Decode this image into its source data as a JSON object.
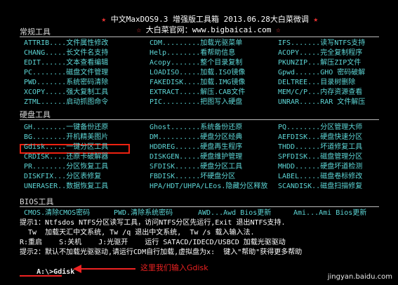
{
  "header": {
    "title_line": "中文MaxDOS9.3 增强版工具箱 2013.06.28大白菜微调",
    "site_line": "大白菜官网：www.bigbaicai.com"
  },
  "sections": {
    "common": "常规工具",
    "disk": "硬盘工具",
    "bios": "BIOS工具"
  },
  "common_rows": [
    [
      "ATTRIB....文件属性修改",
      "CDM.........加载光驱菜单",
      "IFS.......读写NTFS支持"
    ],
    [
      "CHANG.....长文件名支持",
      "Help........看帮助信息",
      "ACOPY.....完全复制程序"
    ],
    [
      "EDIT......文本查看编辑",
      "Acopy.......整个目录复制",
      "PKUNZIP...解压ZIP文件"
    ],
    [
      "PC........磁盘文件管理",
      "LOADISO.....加载.ISO镜像",
      "Gpwd......GHO 密码破解"
    ],
    [
      "PWD.......系统密码清除",
      "FAKEDISK....加载.IMG镜像",
      "DELTREE...目录树删除"
    ],
    [
      "XCOPY.....强大复制工具",
      "EXTRACT.....解压.CAB文件",
      "MEM/C/P...内存资源查看"
    ],
    [
      "ZTML......启动抓图命令",
      "PIC.........把图写入硬盘",
      "UNRAR.....RAR 文件解压"
    ]
  ],
  "disk_rows": [
    [
      "GH........一键备份还原",
      "Ghost.......系统备份还原",
      "PQ........分区管理大师"
    ],
    [
      "BG........开机精美图片",
      "DM..........硬盘分区经典",
      "AEFDISK...硬盘快速分区"
    ],
    [
      "Gdisk.....一键分区工具",
      "HDDREG......硬盘再生程序",
      "THDD......坏道修复工具"
    ],
    [
      "CRDISK....还原卡破解器",
      "DISKGEN.....硬盘维护管理",
      "SPFDISK...磁盘管理分区"
    ],
    [
      "PR........分区恢复工具",
      "SFDISK......硬盘分区工具",
      "MHDD......硬盘坏道检测"
    ],
    [
      "DISKFIX...分区表修复",
      "FBDISK......坏硬盘分区",
      "LABEL.....磁盘卷标修改"
    ],
    [
      "UNERASER..数据恢复工具",
      "HPA/HDT/UHPA/LEos.隐藏分区释放",
      "SCANDISK..磁盘扫描修复"
    ]
  ],
  "bios_row": [
    "CMOS.清除CMOS密码",
    "PWD.清除系统密码",
    "AWD...Awd Bios更新",
    "Ami...Ami Bios更新"
  ],
  "hints": {
    "hint1": "提示1：Ntfsdos NTFS分区读写工具，访问NTFS分区先运行,Exit 退出NTFS支持.",
    "hint_tw": "  Tw  加载天汇中文系统, Tw /q 退出中文系统,  Tw /s 载入输入法.",
    "hint_r": "R:重启    S:关机    J:光驱开    运行 SATACD/IDECD/USBCD 加载光驱驱动",
    "hint2": "提示2：默认不加载光驱驱动,请运行CDM自行加载,虚拟盘为x:  键入\"帮助\"获得更多帮助"
  },
  "prompt": {
    "text": "A:\\>Gdisk"
  },
  "annotation": {
    "caption": "这里我们输入Gdisk",
    "color": "#e22222"
  },
  "watermark": "jingyan.baidu.com",
  "colors": {
    "background": "#000000",
    "star": "#ee3333",
    "cyan": "#5dd6d6"
  }
}
